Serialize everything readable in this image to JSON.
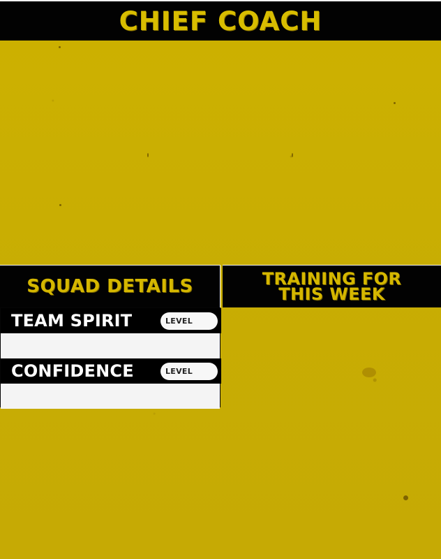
{
  "window": {
    "title": "CHIEF COACH"
  },
  "sections": {
    "squad": {
      "title": "SQUAD DETAILS",
      "items": [
        {
          "label": "TEAM SPIRIT",
          "level_label": "LEVEL"
        },
        {
          "label": "CONFIDENCE",
          "level_label": "LEVEL"
        }
      ]
    },
    "training": {
      "title_line_1": "TRAINING FOR",
      "title_line_2": "THIS WEEK"
    }
  },
  "colors": {
    "background": "#c8ad03",
    "header": "#020202",
    "gold_text": "#d5b700",
    "white": "#ffffff",
    "panel_light": "#f4f4f4"
  }
}
